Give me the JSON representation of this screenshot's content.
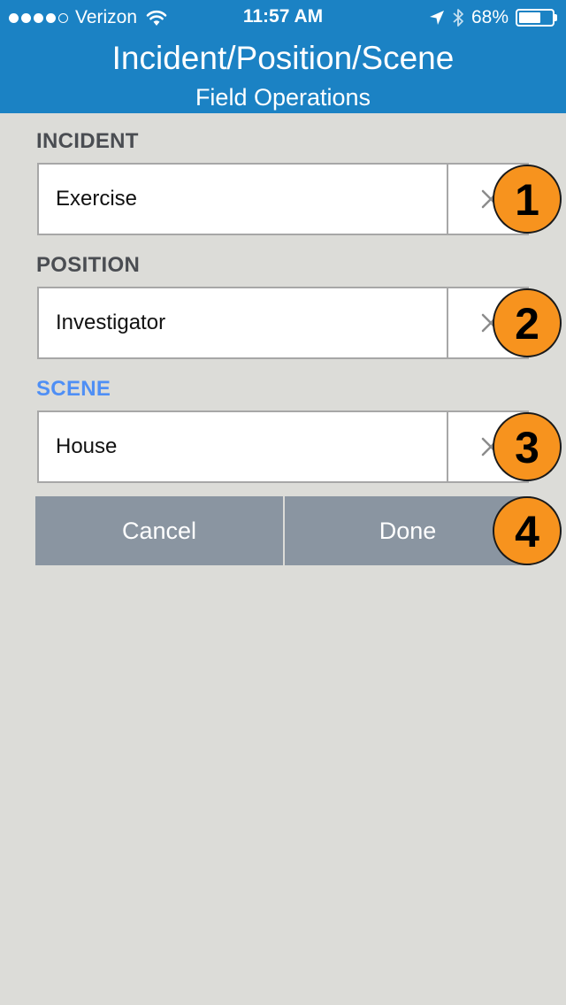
{
  "status_bar": {
    "carrier": "Verizon",
    "time": "11:57 AM",
    "battery": "68%",
    "battery_level": 0.68,
    "signal_bars_filled": 4,
    "signal_bars_total": 5
  },
  "header": {
    "title": "Incident/Position/Scene",
    "subtitle": "Field Operations",
    "background_color": "#1b82c4"
  },
  "sections": {
    "incident": {
      "label": "INCIDENT",
      "value": "Exercise",
      "clear_icon": "close-icon"
    },
    "position": {
      "label": "POSITION",
      "value": "Investigator",
      "clear_icon": "close-icon"
    },
    "scene": {
      "label": "SCENE",
      "value": "House",
      "clear_icon": "close-icon",
      "active_color": "#4f8ff5"
    }
  },
  "actions": {
    "cancel_label": "Cancel",
    "done_label": "Done"
  },
  "markers": [
    "1",
    "2",
    "3",
    "4"
  ],
  "colors": {
    "marker": "#f7931e",
    "button": "#8a95a1",
    "page_background": "#dcdcd8"
  }
}
